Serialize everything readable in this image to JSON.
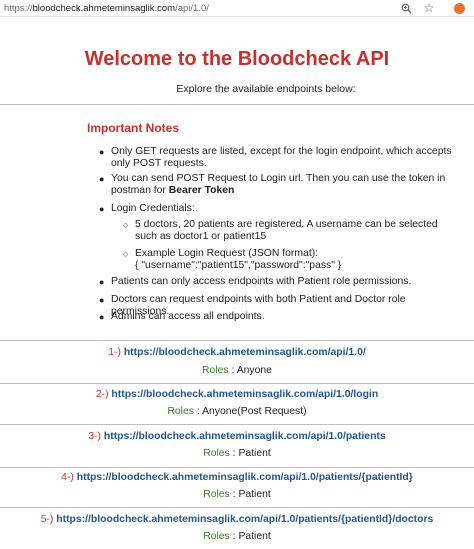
{
  "browser": {
    "url_proto": "https://",
    "url_host": "bloodcheck.ahmeteminsaglik.com",
    "url_path": "/api/1.0/"
  },
  "header": {
    "title": "Welcome to the Bloodcheck API",
    "subtitle": "Explore the available endpoints below:"
  },
  "notes": {
    "title": "Important Notes",
    "item1": "Only GET requests are listed, except for the login endpoint, which accepts only POST requests.",
    "item2_pre": "You can send POST Request to Login url. Then you can use the token in postman for ",
    "item2_bold": "Bearer Token",
    "item3": "Login Credentials:",
    "sub1": "5 doctors, 20 patients are registered. A username can be selected such as doctor1 or patient15",
    "sub2a": "Example Login Request (JSON format):",
    "sub2b": "{ \"username\":\"patient15\",\"password\":\"pass\" }",
    "item4": "Patients can only access endpoints with Patient role permissions.",
    "item5": "Doctors can request endpoints with both Patient and Doctor role permissions.",
    "item6": "Admins can access all endpoints."
  },
  "roles_label": "Roles",
  "roles_sep": " : ",
  "endpoints": [
    {
      "num": "1-)",
      "url": "https://bloodcheck.ahmeteminsaglik.com/api/1.0/",
      "roles": "Anyone"
    },
    {
      "num": "2-)",
      "url": "https://bloodcheck.ahmeteminsaglik.com/api/1.0/login",
      "roles": "Anyone(Post Request)"
    },
    {
      "num": "3-)",
      "url": "https://bloodcheck.ahmeteminsaglik.com/api/1.0/patients",
      "roles": "Patient"
    },
    {
      "num": "4-)",
      "url": "https://bloodcheck.ahmeteminsaglik.com/api/1.0/patients/{patientId}",
      "roles": "Patient"
    },
    {
      "num": "5-)",
      "url": "https://bloodcheck.ahmeteminsaglik.com/api/1.0/patients/{patientId}/doctors",
      "roles": "Patient"
    }
  ],
  "icons": {
    "zoom": "zoom-icon",
    "star": "bookmark-star-icon",
    "extension": "extension-icon"
  },
  "colors": {
    "title": "#c8302b",
    "link": "#23568f",
    "roles": "#3a7b2a"
  }
}
